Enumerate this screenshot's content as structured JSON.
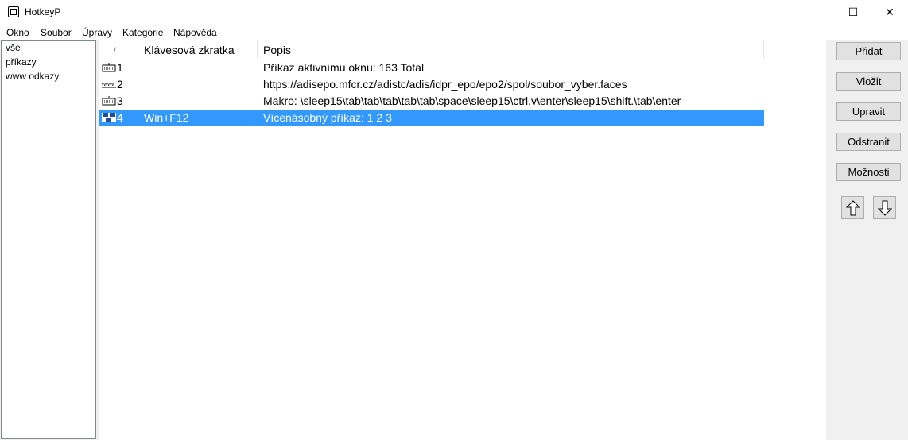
{
  "window": {
    "title": "HotkeyP"
  },
  "titlebar": {
    "minimize": "—",
    "maximize": "☐",
    "close": "✕"
  },
  "menu": [
    {
      "label": "Okno",
      "hotkey_index": 1
    },
    {
      "label": "Soubor",
      "hotkey_index": 0
    },
    {
      "label": "Úpravy",
      "hotkey_index": 0
    },
    {
      "label": "Kategorie",
      "hotkey_index": 0
    },
    {
      "label": "Nápověda",
      "hotkey_index": 0
    }
  ],
  "categories": [
    "vše",
    "příkazy",
    "www odkazy"
  ],
  "list": {
    "headers": {
      "number": "/",
      "hotkey": "Klávesová zkratka",
      "description": "Popis"
    },
    "rows": [
      {
        "icon": "keyboard-icon",
        "number": "1",
        "hotkey": "",
        "description": "Příkaz aktivnímu oknu: 163 Total",
        "selected": false
      },
      {
        "icon": "www-icon",
        "number": "2",
        "hotkey": "",
        "description": "https://adisepo.mfcr.cz/adistc/adis/idpr_epo/epo2/spol/soubor_vyber.faces",
        "selected": false
      },
      {
        "icon": "keyboard-icon",
        "number": "3",
        "hotkey": "",
        "description": "Makro: \\sleep15\\tab\\tab\\tab\\tab\\tab\\space\\sleep15\\ctrl.v\\enter\\sleep15\\shift.\\tab\\enter",
        "selected": false
      },
      {
        "icon": "multi-command-icon",
        "number": "4",
        "hotkey": "Win+F12",
        "description": "Vícenásobný příkaz: 1 2 3",
        "selected": true
      }
    ]
  },
  "buttons": {
    "add": "Přidat",
    "paste": "Vložit",
    "edit": "Upravit",
    "remove": "Odstranit",
    "options": "Možnosti"
  },
  "colors": {
    "selection": "#3399ff",
    "window_bg": "#f0f0f0"
  }
}
